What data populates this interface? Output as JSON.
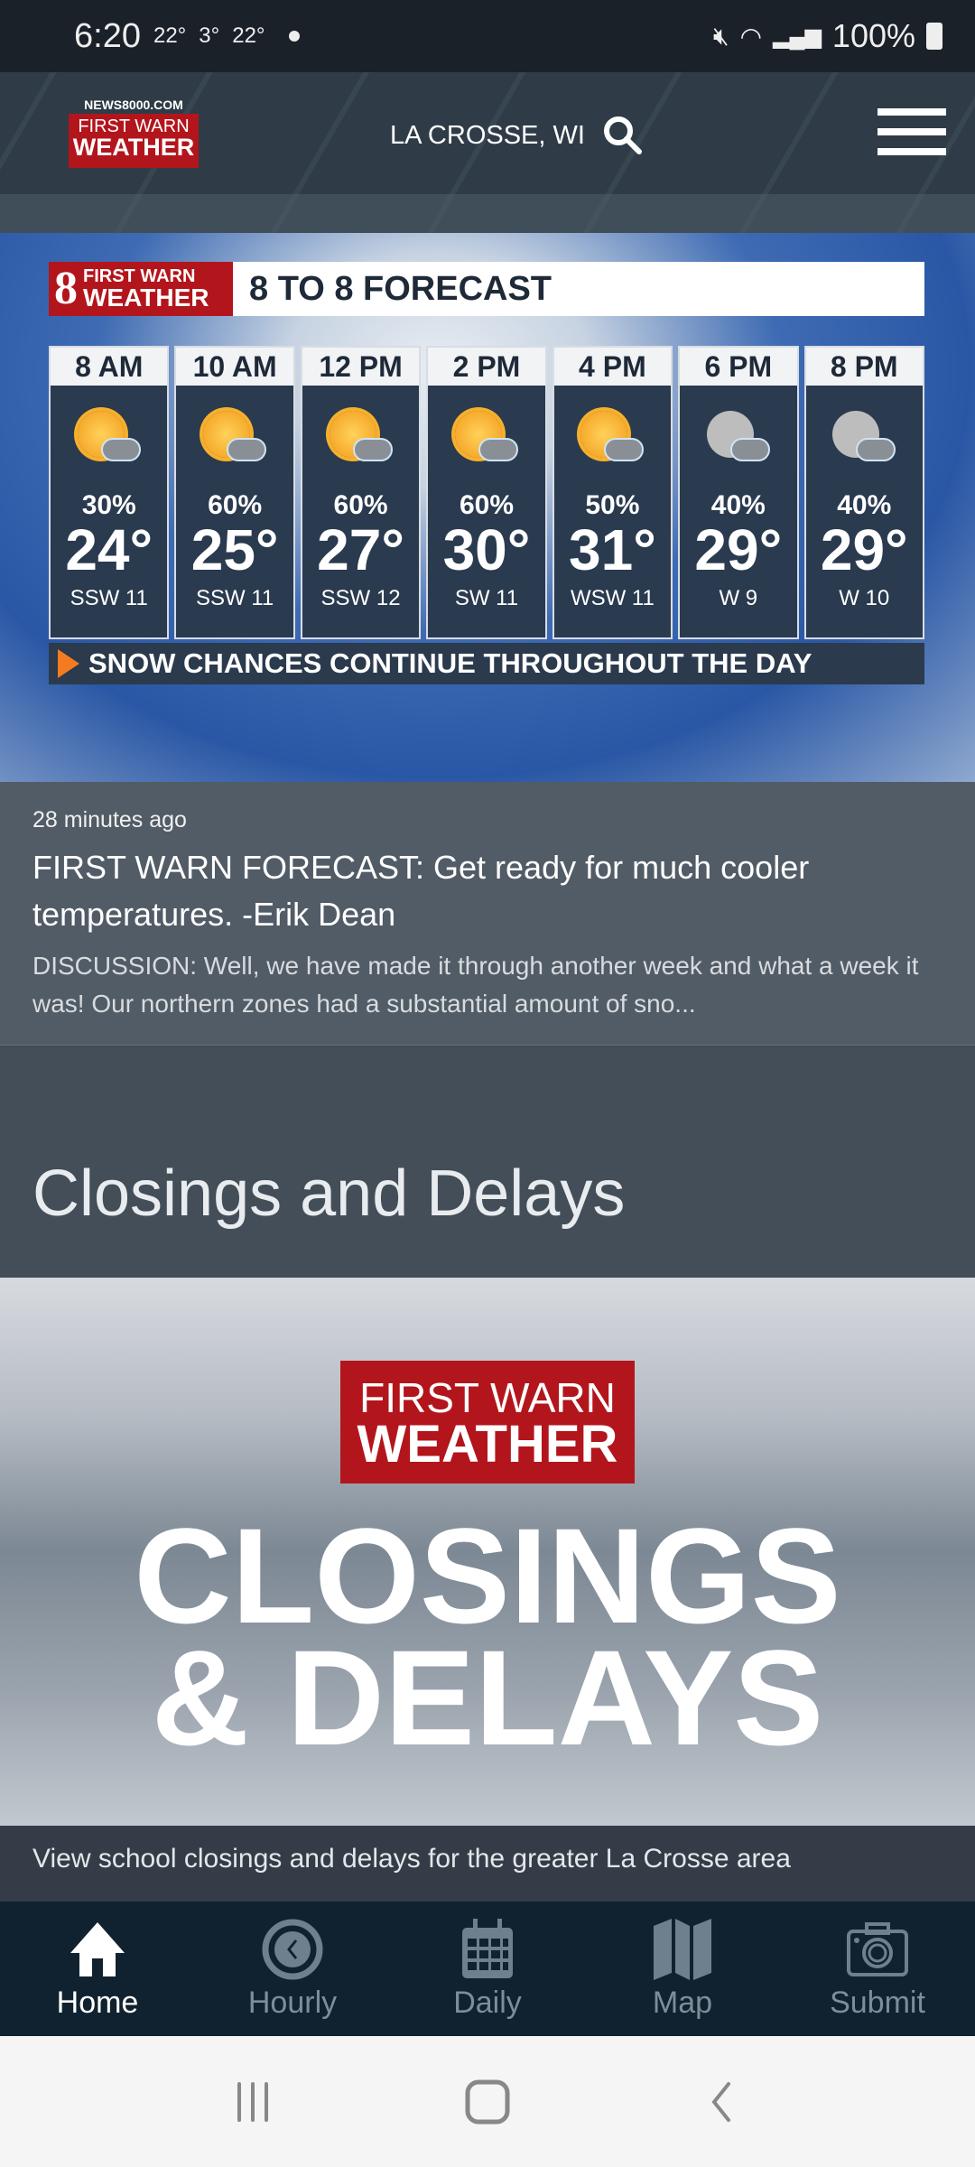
{
  "status_bar": {
    "time": "6:20",
    "temps": [
      "22°",
      "3°",
      "22°"
    ],
    "battery": "100%"
  },
  "header": {
    "logo_top": "NEWS8000.COM",
    "logo_line1": "FIRST WARN",
    "logo_line2": "WEATHER",
    "location": "LA CROSSE, WI"
  },
  "forecast_graphic": {
    "logo_number": "8",
    "logo_line1": "FIRST WARN",
    "logo_line2": "WEATHER",
    "title": "8 TO 8 FORECAST",
    "hours": [
      {
        "time": "8 AM",
        "icon": "sun-cloud-snow",
        "precip": "30%",
        "temp": "24°",
        "wind": "SSW 11"
      },
      {
        "time": "10 AM",
        "icon": "sun-cloud-snow",
        "precip": "60%",
        "temp": "25°",
        "wind": "SSW 11"
      },
      {
        "time": "12 PM",
        "icon": "sun-cloud-snow",
        "precip": "60%",
        "temp": "27°",
        "wind": "SSW 12"
      },
      {
        "time": "2 PM",
        "icon": "sun-cloud-snow",
        "precip": "60%",
        "temp": "30°",
        "wind": "SW 11"
      },
      {
        "time": "4 PM",
        "icon": "sun-cloud-snow",
        "precip": "50%",
        "temp": "31°",
        "wind": "WSW 11"
      },
      {
        "time": "6 PM",
        "icon": "moon-cloud-snow",
        "precip": "40%",
        "temp": "29°",
        "wind": "W 9"
      },
      {
        "time": "8 PM",
        "icon": "moon-cloud-snow",
        "precip": "40%",
        "temp": "29°",
        "wind": "W 10"
      }
    ],
    "note": "SNOW CHANCES CONTINUE THROUGHOUT THE DAY"
  },
  "article": {
    "timestamp": "28 minutes ago",
    "title": "FIRST WARN FORECAST: Get ready for much cooler temperatures. -Erik Dean",
    "description": " DISCUSSION: Well, we have made it through another week and what a week it was! Our northern zones had a substantial amount of sno..."
  },
  "closings": {
    "heading": "Closings and Delays",
    "badge_line1": "FIRST WARN",
    "badge_line2": "WEATHER",
    "big_line1": "CLOSINGS",
    "big_line2": "& DELAYS",
    "caption": "View school closings and delays for the greater La Crosse area"
  },
  "nav": {
    "items": [
      {
        "label": "Home",
        "icon": "home-icon"
      },
      {
        "label": "Hourly",
        "icon": "clock-icon"
      },
      {
        "label": "Daily",
        "icon": "calendar-icon"
      },
      {
        "label": "Map",
        "icon": "map-icon"
      },
      {
        "label": "Submit",
        "icon": "camera-icon"
      }
    ]
  },
  "colors": {
    "brand_red": "#b3151c",
    "nav_bg": "#10222f",
    "accent_orange": "#f47b20"
  }
}
